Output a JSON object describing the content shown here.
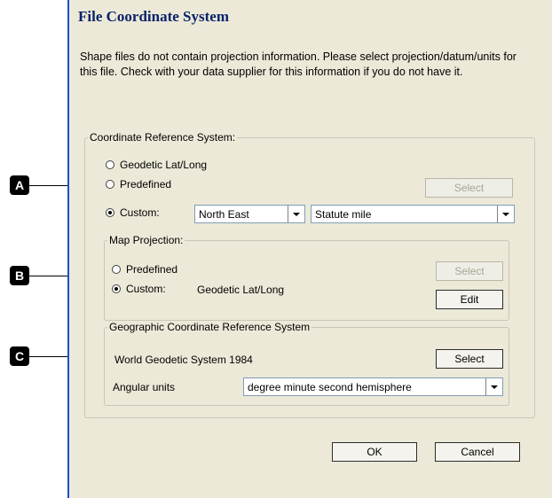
{
  "dialog": {
    "title": "File Coordinate System",
    "description": "Shape files do not contain projection information. Please select projection/datum/units for this file. Check with your data supplier for this information if you do not have it."
  },
  "crs": {
    "legend": "Coordinate Reference System:",
    "options": {
      "geodetic": "Geodetic Lat/Long",
      "predefined": "Predefined",
      "custom": "Custom:"
    },
    "selected": "custom",
    "select_button": "Select",
    "axis_combo": "North East",
    "units_combo": "Statute mile"
  },
  "map_projection": {
    "legend": "Map Projection:",
    "predefined": "Predefined",
    "custom": "Custom:",
    "custom_value": "Geodetic Lat/Long",
    "selected": "custom",
    "select_button": "Select",
    "edit_button": "Edit"
  },
  "gcrs": {
    "legend": "Geographic Coordinate Reference System",
    "datum": "World Geodetic System 1984",
    "select_button": "Select",
    "angular_label": "Angular units",
    "angular_value": "degree minute second hemisphere"
  },
  "buttons": {
    "ok": "OK",
    "cancel": "Cancel"
  },
  "callouts": [
    "A",
    "B",
    "C"
  ],
  "colors": {
    "title": "#0a246a",
    "dialog_bg": "#ece9d8",
    "frame_blue": "#1b4fd0"
  }
}
